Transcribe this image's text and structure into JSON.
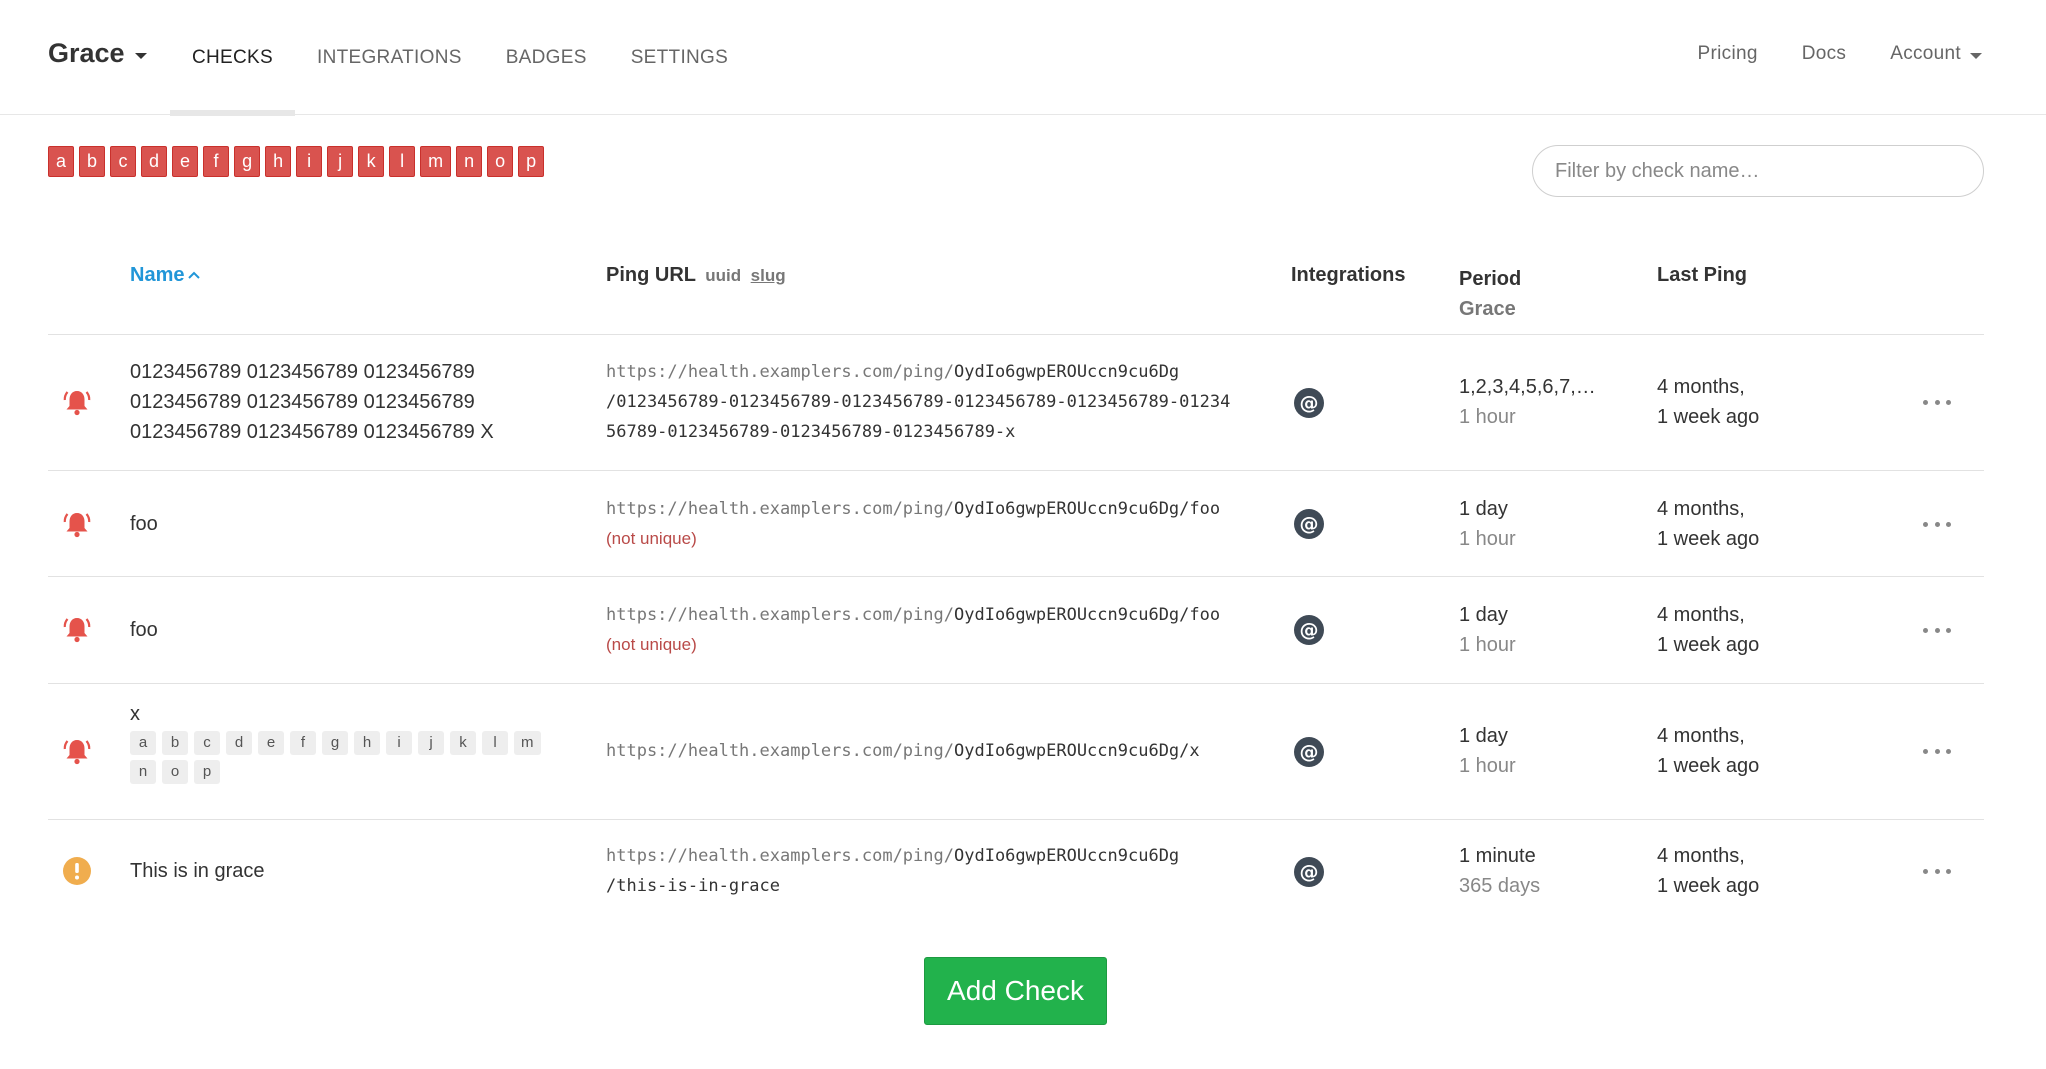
{
  "nav": {
    "brand": "Grace",
    "items": [
      "CHECKS",
      "INTEGRATIONS",
      "BADGES",
      "SETTINGS"
    ],
    "right": [
      "Pricing",
      "Docs",
      "Account"
    ]
  },
  "tags": [
    "a",
    "b",
    "c",
    "d",
    "e",
    "f",
    "g",
    "h",
    "i",
    "j",
    "k",
    "l",
    "m",
    "n",
    "o",
    "p"
  ],
  "filter": {
    "placeholder": "Filter by check name…"
  },
  "table": {
    "headers": {
      "name": "Name",
      "ping_url": "Ping URL",
      "mode_uuid": "uuid",
      "mode_slug": "slug",
      "integrations": "Integrations",
      "period": "Period",
      "grace": "Grace",
      "last_ping": "Last Ping"
    },
    "rows": [
      {
        "status": "down",
        "name_lines": [
          "0123456789 0123456789 0123456789",
          "0123456789 0123456789 0123456789",
          "0123456789 0123456789 0123456789 X"
        ],
        "url_base": "https://health.examplers.com/ping/",
        "url_lines": [
          "OydIo6gwpEROUccn9cu6Dg",
          "/0123456789-0123456789-0123456789-0123456789-0123456789-01234",
          "56789-0123456789-0123456789-0123456789-x"
        ],
        "period": "1,2,3,4,5,6,7,…",
        "grace": "1 hour",
        "last_ping_1": "4 months,",
        "last_ping_2": "1 week ago"
      },
      {
        "status": "down",
        "name": "foo",
        "url_base": "https://health.examplers.com/ping/",
        "url_rest": "OydIo6gwpEROUccn9cu6Dg/foo",
        "note": "(not unique)",
        "period": "1 day",
        "grace": "1 hour",
        "last_ping_1": "4 months,",
        "last_ping_2": "1 week ago"
      },
      {
        "status": "down",
        "name": "foo",
        "url_base": "https://health.examplers.com/ping/",
        "url_rest": "OydIo6gwpEROUccn9cu6Dg/foo",
        "note": "(not unique)",
        "period": "1 day",
        "grace": "1 hour",
        "last_ping_1": "4 months,",
        "last_ping_2": "1 week ago"
      },
      {
        "status": "down",
        "name": "x",
        "tags": [
          "a",
          "b",
          "c",
          "d",
          "e",
          "f",
          "g",
          "h",
          "i",
          "j",
          "k",
          "l",
          "m",
          "n",
          "o",
          "p"
        ],
        "url_base": "https://health.examplers.com/ping/",
        "url_rest": "OydIo6gwpEROUccn9cu6Dg/x",
        "period": "1 day",
        "grace": "1 hour",
        "last_ping_1": "4 months,",
        "last_ping_2": "1 week ago"
      },
      {
        "status": "grace",
        "name": "This is in grace",
        "url_base": "https://health.examplers.com/ping/",
        "url_line1": "OydIo6gwpEROUccn9cu6Dg",
        "url_line2": "/this-is-in-grace",
        "period": "1 minute",
        "grace": "365 days",
        "last_ping_1": "4 months,",
        "last_ping_2": "1 week ago"
      }
    ]
  },
  "add_check": "Add Check",
  "colors": {
    "down": "#e5534b",
    "grace": "#f0ad4e",
    "accent": "#2196d8",
    "success": "#22b24c",
    "tag": "#d9534f"
  },
  "icons": {
    "status_down": "bell-icon",
    "status_grace": "exclamation-circle-icon",
    "integration": "at-sign-icon",
    "row_menu": "ellipsis-icon",
    "sort": "chevron-up-icon"
  }
}
